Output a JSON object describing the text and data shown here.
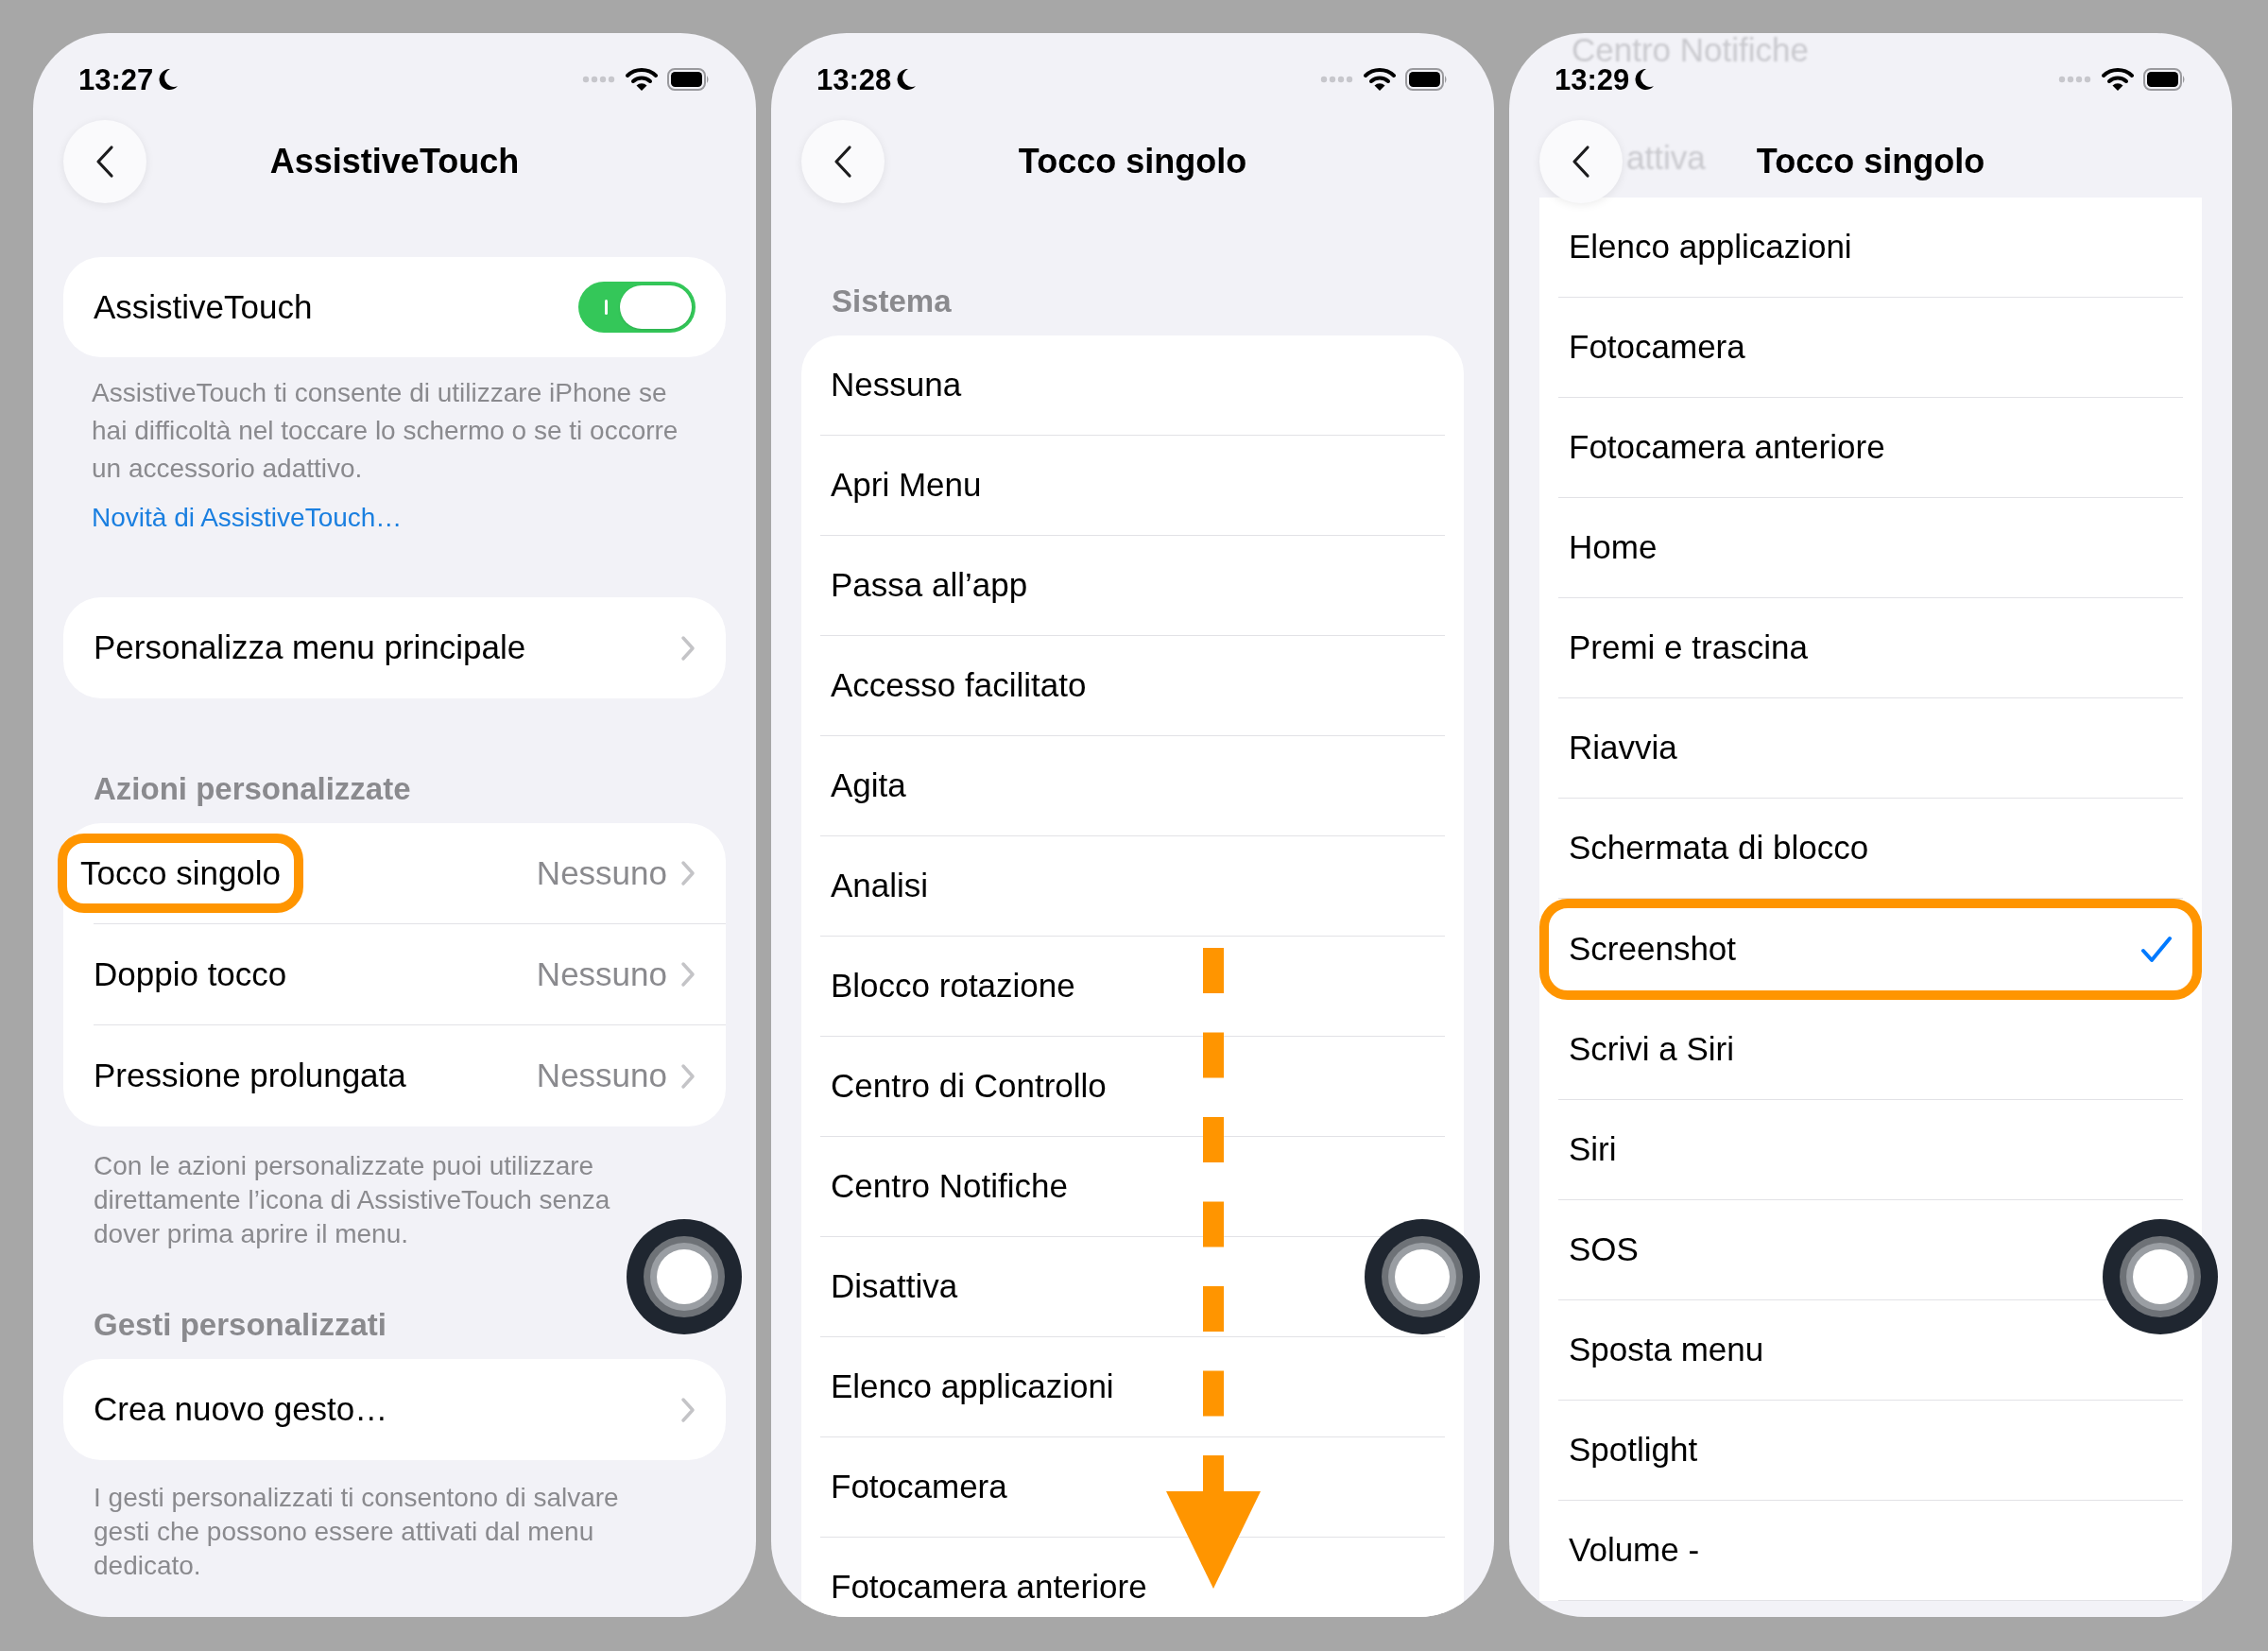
{
  "screens": [
    {
      "kind": "settings",
      "time": "13:27",
      "title": "AssistiveTouch",
      "toggle": {
        "label": "AssistiveTouch",
        "on": true
      },
      "toggle_note": "AssistiveTouch ti consente di utilizzare iPhone se hai difficoltà nel toccare lo schermo o se ti occorre un accessorio adattivo.",
      "link": "Novità di AssistiveTouch…",
      "menu_row": "Personalizza menu principale",
      "actions": {
        "header": "Azioni personalizzate",
        "rows": [
          {
            "label": "Tocco singolo",
            "value": "Nessuno",
            "highlighted": true
          },
          {
            "label": "Doppio tocco",
            "value": "Nessuno",
            "highlighted": false
          },
          {
            "label": "Pressione prolungata",
            "value": "Nessuno",
            "highlighted": false
          }
        ],
        "note": "Con le azioni personalizzate puoi utilizzare direttamente l’icona di AssistiveTouch senza dover prima aprire il menu."
      },
      "gestures": {
        "header": "Gesti personalizzati",
        "row": "Crea nuovo gesto…",
        "note": "I gesti personalizzati ti consentono di salvare gesti che possono essere attivati dal menu dedicato."
      }
    },
    {
      "kind": "list",
      "time": "13:28",
      "title": "Tocco singolo",
      "section": "Sistema",
      "scroll_arrow": true,
      "items": [
        {
          "label": "Nessuna",
          "checked": false,
          "highlighted": false
        },
        {
          "label": "Apri Menu",
          "checked": false,
          "highlighted": false
        },
        {
          "label": "Passa all’app",
          "checked": false,
          "highlighted": false
        },
        {
          "label": "Accesso facilitato",
          "checked": false,
          "highlighted": false
        },
        {
          "label": "Agita",
          "checked": false,
          "highlighted": false
        },
        {
          "label": "Analisi",
          "checked": false,
          "highlighted": false
        },
        {
          "label": "Blocco rotazione",
          "checked": false,
          "highlighted": false
        },
        {
          "label": "Centro di Controllo",
          "checked": false,
          "highlighted": false
        },
        {
          "label": "Centro Notifiche",
          "checked": false,
          "highlighted": false
        },
        {
          "label": "Disattiva",
          "checked": false,
          "highlighted": false
        },
        {
          "label": "Elenco applicazioni",
          "checked": false,
          "highlighted": false
        },
        {
          "label": "Fotocamera",
          "checked": false,
          "highlighted": false
        },
        {
          "label": "Fotocamera anteriore",
          "checked": false,
          "highlighted": false
        }
      ]
    },
    {
      "kind": "list",
      "time": "13:29",
      "title": "Tocco singolo",
      "scrolled_under": [
        "Centro Notifiche",
        "attiva"
      ],
      "items": [
        {
          "label": "Elenco applicazioni",
          "checked": false,
          "highlighted": false
        },
        {
          "label": "Fotocamera",
          "checked": false,
          "highlighted": false
        },
        {
          "label": "Fotocamera anteriore",
          "checked": false,
          "highlighted": false
        },
        {
          "label": "Home",
          "checked": false,
          "highlighted": false
        },
        {
          "label": "Premi e trascina",
          "checked": false,
          "highlighted": false
        },
        {
          "label": "Riavvia",
          "checked": false,
          "highlighted": false
        },
        {
          "label": "Schermata di blocco",
          "checked": false,
          "highlighted": false
        },
        {
          "label": "Screenshot",
          "checked": true,
          "highlighted": true
        },
        {
          "label": "Scrivi a Siri",
          "checked": false,
          "highlighted": false
        },
        {
          "label": "Siri",
          "checked": false,
          "highlighted": false
        },
        {
          "label": "SOS",
          "checked": false,
          "highlighted": false
        },
        {
          "label": "Sposta menu",
          "checked": false,
          "highlighted": false
        },
        {
          "label": "Spotlight",
          "checked": false,
          "highlighted": false
        },
        {
          "label": "Volume -",
          "checked": false,
          "highlighted": false
        }
      ]
    }
  ]
}
